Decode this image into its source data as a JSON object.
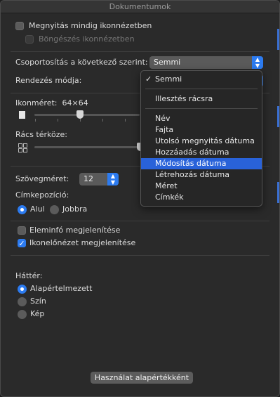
{
  "window": {
    "title": "Dokumentumok"
  },
  "options": {
    "always_open_icon": {
      "label": "Megnyitás mindig ikonnézetben",
      "checked": false
    },
    "browse_icon": {
      "label": "Böngészés ikonnézetben",
      "checked": false,
      "disabled": true
    },
    "group_by": {
      "label": "Csoportosítás a következő szerint:",
      "value": "Semmi"
    },
    "sort_by": {
      "label": "Rendezés módja:"
    },
    "icon_size": {
      "label": "Ikonméret:",
      "value": "64×64"
    },
    "grid_spacing": {
      "label": "Rács térköze:"
    },
    "text_size": {
      "label": "Szövegméret:",
      "value": "12"
    },
    "label_position": {
      "label": "Címkepozíció:",
      "options": [
        {
          "label": "Alul",
          "selected": true
        },
        {
          "label": "Jobbra",
          "selected": false
        }
      ]
    },
    "show_item_info": {
      "label": "Eleminfó megjelenítése",
      "checked": false
    },
    "show_icon_preview": {
      "label": "Ikonelőnézet megjelenítése",
      "checked": true
    },
    "background": {
      "label": "Háttér:",
      "options": [
        {
          "label": "Alapértelmezett",
          "selected": true
        },
        {
          "label": "Szín",
          "selected": false
        },
        {
          "label": "Kép",
          "selected": false
        }
      ]
    },
    "use_default_button": "Használat alapértékként"
  },
  "sort_menu": {
    "items": [
      {
        "label": "Semmi",
        "checked": true
      },
      {
        "label": "Illesztés rácsra"
      },
      {
        "label": "Név"
      },
      {
        "label": "Fajta"
      },
      {
        "label": "Utolsó megnyitás dátuma"
      },
      {
        "label": "Hozzáadás dátuma"
      },
      {
        "label": "Módosítás dátuma",
        "highlighted": true
      },
      {
        "label": "Létrehozás dátuma"
      },
      {
        "label": "Méret"
      },
      {
        "label": "Címkék"
      }
    ],
    "checkmark": "✓"
  },
  "icons": {
    "checkmark": "✓",
    "popup_arrows": "⌃⌄"
  }
}
